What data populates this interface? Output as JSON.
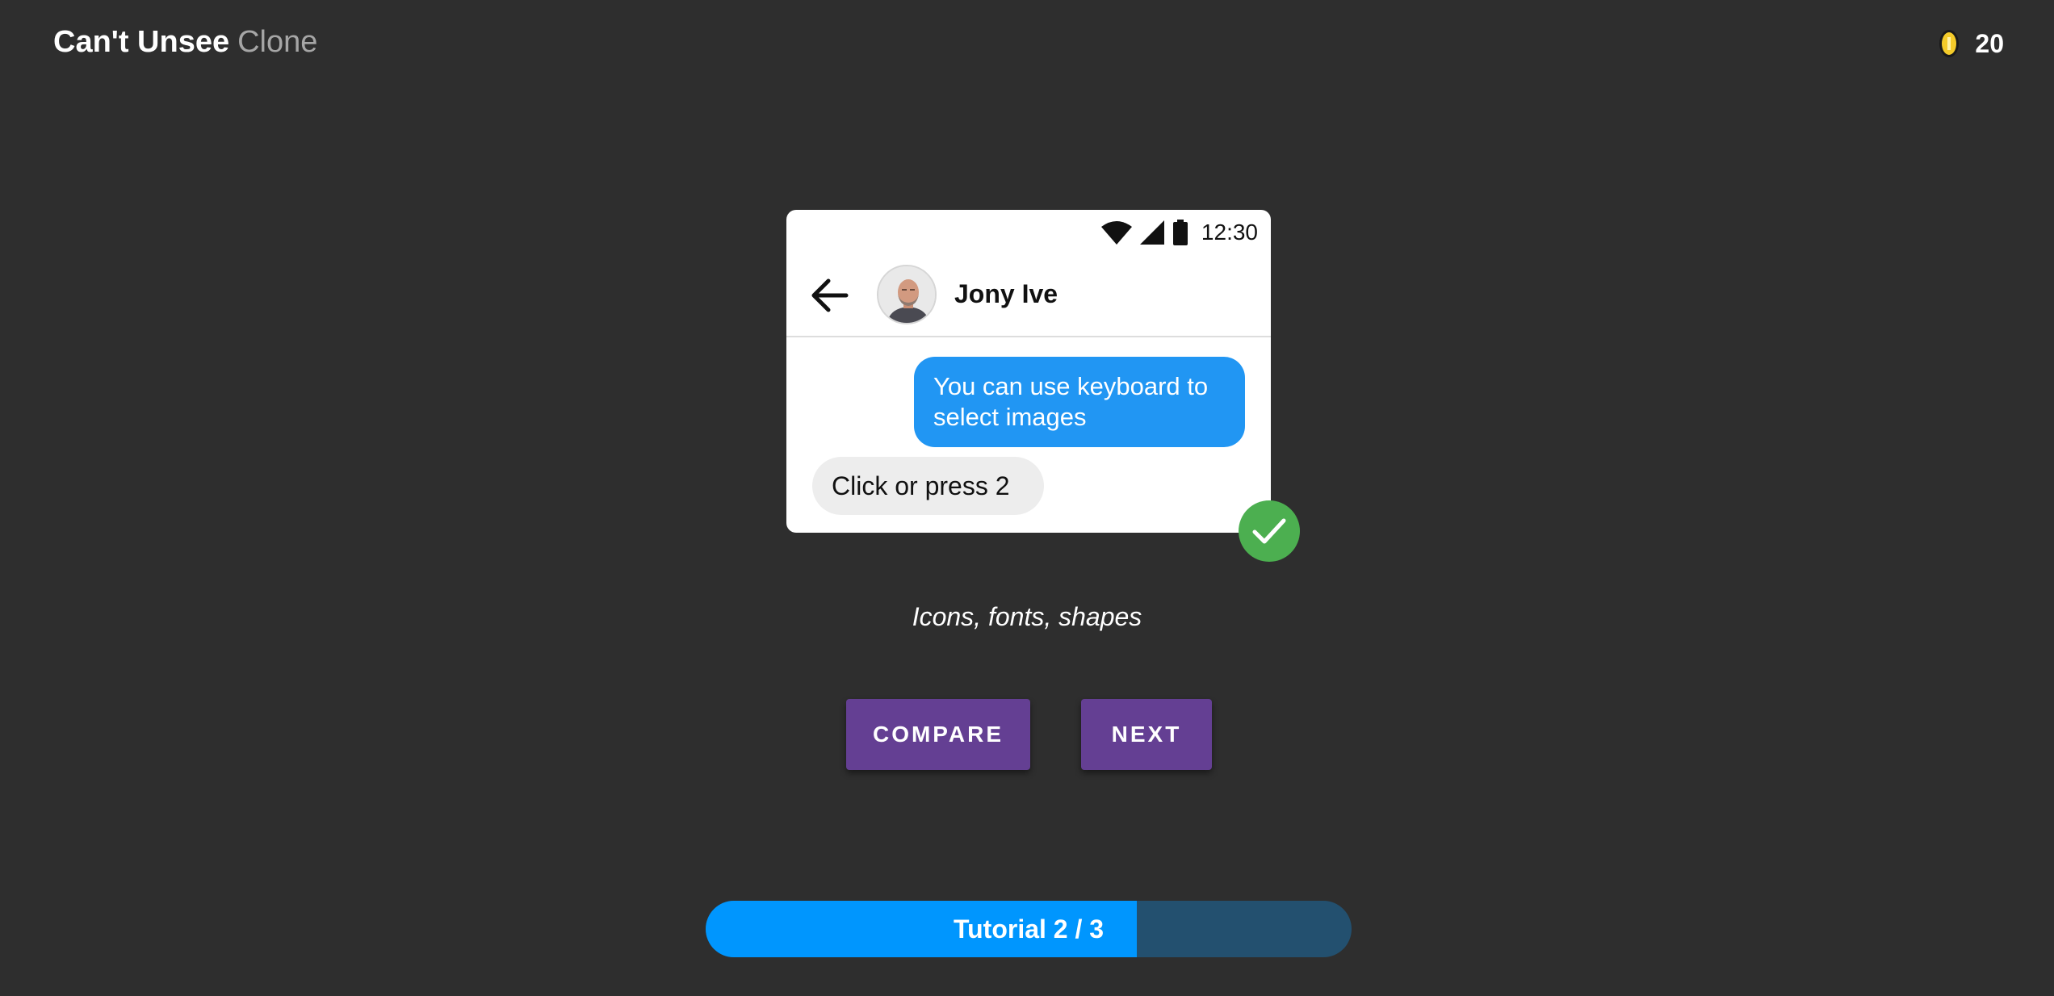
{
  "header": {
    "title_strong": "Can't Unsee",
    "title_light": "Clone",
    "coins": {
      "icon": "coin-icon",
      "count": "20"
    }
  },
  "phone": {
    "status_bar": {
      "icons": [
        "wifi-icon",
        "signal-icon",
        "battery-icon"
      ],
      "time": "12:30"
    },
    "app_bar": {
      "back_icon": "arrow-left-icon",
      "avatar_icon": "avatar",
      "contact_name": "Jony Ive"
    },
    "messages": {
      "outgoing": "You can use keyboard to select images",
      "incoming": "Click or press 2"
    }
  },
  "check_icon": "check-icon",
  "caption": "Icons, fonts, shapes",
  "buttons": {
    "compare": "COMPARE",
    "next": "NEXT"
  },
  "progress": {
    "label": "Tutorial 2 / 3",
    "current": 2,
    "total": 3,
    "fill_fraction": 0.667
  },
  "colors": {
    "background": "#2e2e2e",
    "button": "#643f93",
    "bubble_out": "#2196f3",
    "check": "#4caf50",
    "progress_fill": "#0096fe",
    "progress_track": "#23506f"
  }
}
